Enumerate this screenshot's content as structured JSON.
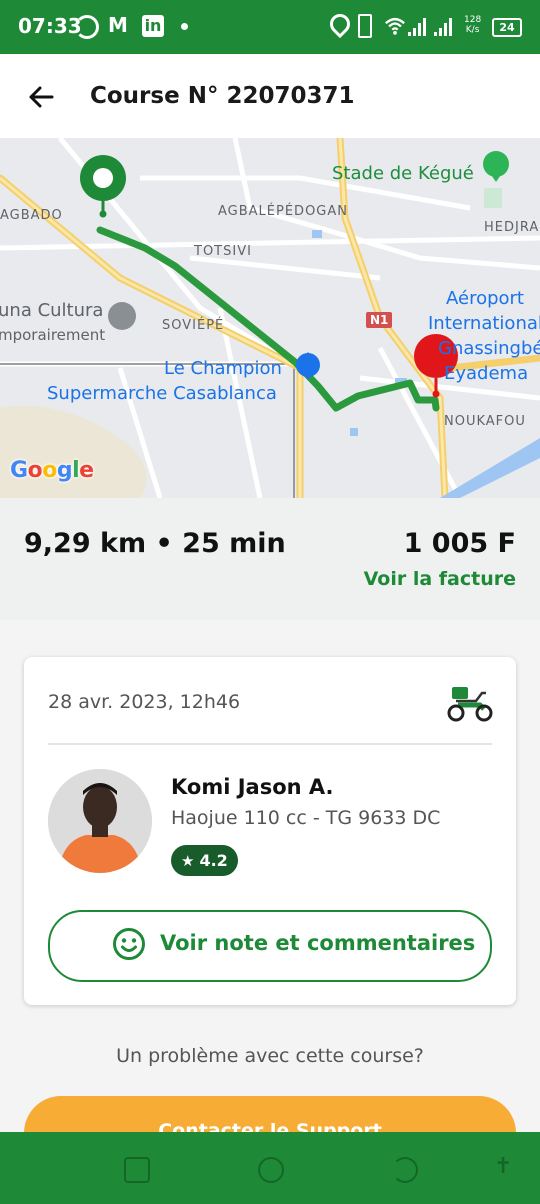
{
  "status_bar": {
    "time": "07:33",
    "speed_value": "128",
    "speed_unit": "K/s",
    "battery": "24"
  },
  "header": {
    "title": "Course N° 22070371"
  },
  "map": {
    "labels": {
      "agbado": "AGBADO",
      "agbalepedogan": "AGBALÉPÉDOGAN",
      "totsivi": "TOTSIVI",
      "hedjra": "HEDJRA",
      "soviepe": "SOVIÉPÉ",
      "noukafou": "NOUKAFOU",
      "n1": "N1"
    },
    "pois": {
      "stade": "Stade de Kégué",
      "aeroport_1": "Aéroport",
      "aeroport_2": "International",
      "aeroport_3": "Gnassingbé",
      "aeroport_4": "Eyadema",
      "champion_1": "Le Champion",
      "champion_2": "Supermarche Casablanca",
      "cultura_1": "una Cultura",
      "cultura_2": "mporairement"
    },
    "google": "Google"
  },
  "summary": {
    "distance_time": "9,29 km • 25 min",
    "price": "1 005 F",
    "invoice_link": "Voir la facture"
  },
  "card": {
    "date": "28 avr. 2023, 12h46",
    "driver_name": "Komi Jason A.",
    "vehicle": "Haojue 110 cc - TG 9633 DC",
    "rating": "4.2",
    "reviews_button": "Voir note et commentaires"
  },
  "problem_text": "Un problème avec cette course?",
  "support_button": "Contacter le Support",
  "colors": {
    "primary_green": "#1e8a37",
    "accent_orange": "#f6ac35",
    "rating_badge": "#175c2a",
    "route": "#2b9a3e",
    "destination_pin": "#e0161b"
  }
}
